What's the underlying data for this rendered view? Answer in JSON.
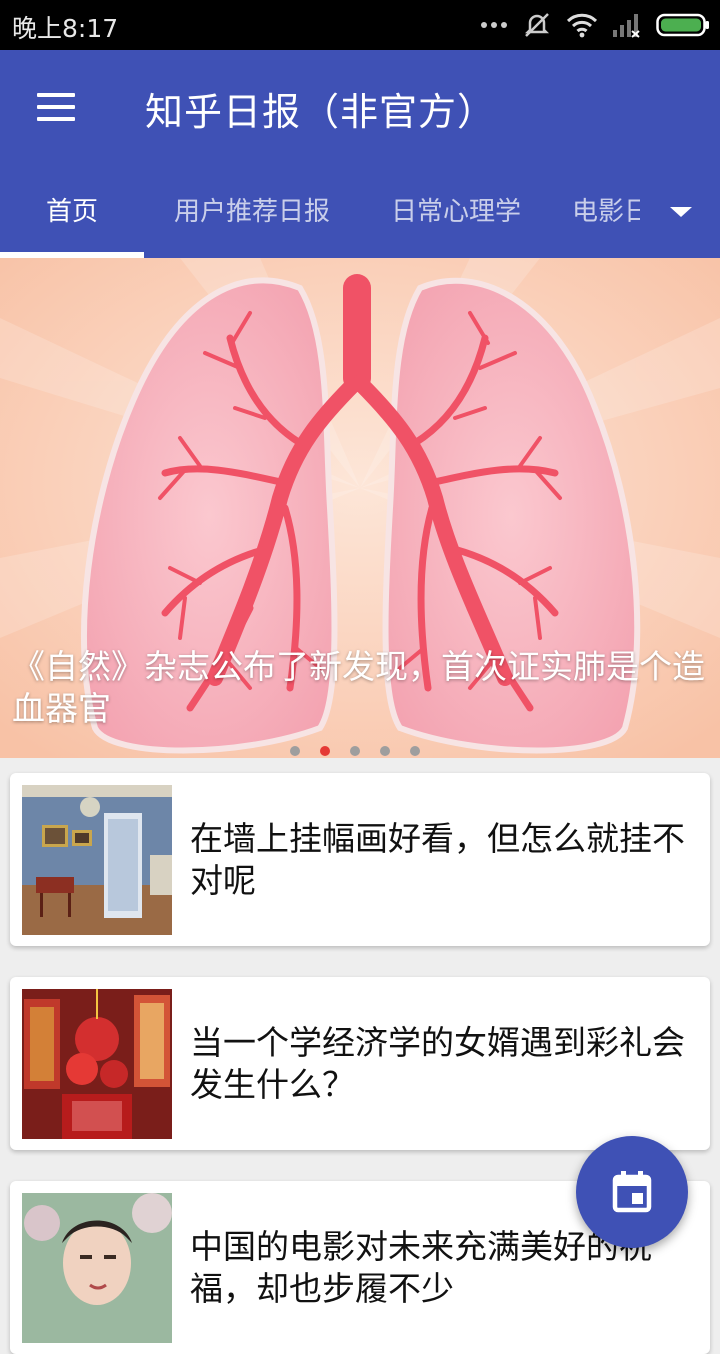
{
  "status_bar": {
    "time": "晚上8:17",
    "icons": [
      "more-dots-icon",
      "mute-icon",
      "wifi-icon",
      "signal-icon",
      "battery-icon"
    ]
  },
  "toolbar": {
    "menu_icon": "hamburger-menu-icon",
    "title": "知乎日报（非官方）",
    "background_color": "#3f51b5"
  },
  "tabs": [
    {
      "label": "首页",
      "active": true
    },
    {
      "label": "用户推荐日报",
      "active": false
    },
    {
      "label": "日常心理学",
      "active": false
    },
    {
      "label": "电影日报",
      "active": false
    }
  ],
  "tabs_more_icon": "dropdown-arrow-icon",
  "banner": {
    "title": "《自然》杂志公布了新发现，首次证实肺是个造血器官",
    "page_count": 5,
    "active_index": 1
  },
  "stories": [
    {
      "title": "在墙上挂幅画好看，但怎么就挂不对呢",
      "thumb": "palace-room-image"
    },
    {
      "title": "当一个学经济学的女婿遇到彩礼会发生什么？",
      "thumb": "red-lanterns-image"
    },
    {
      "title": "中国的电影对未来充满美好的祝福，却也步履不少",
      "thumb": "portrait-image"
    }
  ],
  "fab": {
    "icon": "calendar-icon"
  }
}
